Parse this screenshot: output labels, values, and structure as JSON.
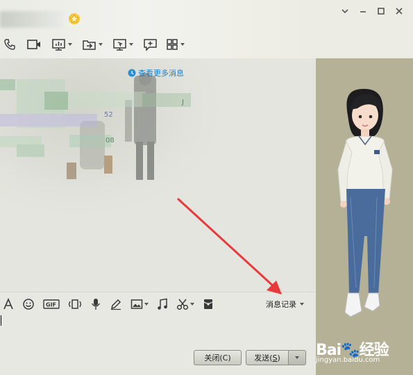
{
  "messages": {
    "view_more": "查看更多消息",
    "fragment_1": "52",
    "fragment_2": "08",
    "fragment_3": "J"
  },
  "bottom_toolbar": {
    "message_record": "消息记录"
  },
  "buttons": {
    "close": "关闭(C)",
    "send_prefix": "发送(",
    "send_key": "S",
    "send_suffix": ")"
  },
  "watermark": {
    "brand": "Bai",
    "brand_suffix": "经验",
    "url": "jingyan.baidu.com"
  },
  "colors": {
    "link": "#1f7fc9",
    "arrow": "#e8393b",
    "side_panel": "#b5b196"
  }
}
